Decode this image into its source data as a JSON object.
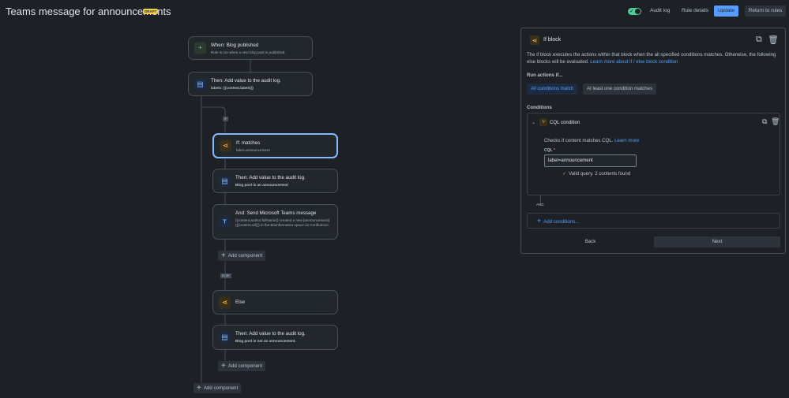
{
  "header": {
    "title": "Teams message for announcements",
    "draft_badge": "DRAFT",
    "toggle_state": "on",
    "audit_log_label": "Audit log",
    "rule_details_label": "Rule details",
    "update_label": "Update",
    "return_label": "Return to rules"
  },
  "flow": {
    "trigger": {
      "title": "When: Blog published",
      "subtitle": "Rule is run when a new blog post is published."
    },
    "audit1": {
      "title": "Then: Add value to the audit log.",
      "subtitle": "labels: {{content.labels}}"
    },
    "if_tag": "IF",
    "if_node": {
      "title": "If: matches",
      "subtitle": "label=announcement"
    },
    "audit2": {
      "title": "Then: Add value to the audit log.",
      "subtitle": "Blog post is an announcement"
    },
    "teams": {
      "title": "And: Send Microsoft Teams message",
      "subtitle": "{{content.author.fullName}} created a new [announcement]({{content.url}}) in the Bioinformatics space on Confluence."
    },
    "add_component_1": "Add component",
    "else_tag": "ELSE",
    "else_node": {
      "title": "Else"
    },
    "audit3": {
      "title": "Then: Add value to the audit log.",
      "subtitle": "Blog post is not an announcement."
    },
    "add_component_2": "Add component",
    "add_component_3": "Add component"
  },
  "panel": {
    "title": "If block",
    "description": "The if block executes the actions within that block when the all specified conditions matches. Otherwise, the following else blocks will be evaluated.",
    "learn_more": "Learn more about if / else block condition",
    "run_label": "Run actions if...",
    "option_all": "All conditions match",
    "option_one": "At least one condition matches",
    "conditions_label": "Conditions",
    "condition": {
      "title": "CQL condition",
      "description": "Checks if content matches CQL.",
      "learn_more": "Learn more",
      "field_label": "CQL",
      "required_mark": "*",
      "value": "label=announcement",
      "validation": "Valid query. 2 contents found"
    },
    "and_label": "AND",
    "add_conditions": "Add conditions...",
    "back_label": "Back",
    "next_label": "Next"
  },
  "colors": {
    "background": "#1d2125",
    "accent": "#579dff",
    "selected_border": "#85b8ff",
    "success": "#4bce97",
    "draft": "#f5cd47"
  }
}
